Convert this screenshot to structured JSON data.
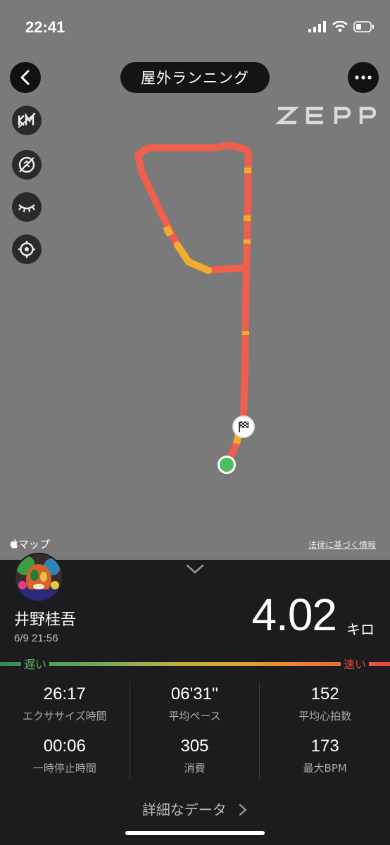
{
  "status_bar": {
    "time": "22:41"
  },
  "header": {
    "title": "屋外ランニング",
    "back_icon": "back-chevron-icon",
    "more_icon": "more-dots-icon"
  },
  "map": {
    "brand": "ZΣPP",
    "apple_maps_label": "マップ",
    "legal_link": "法律に基づく情報",
    "tools": [
      "km-marker-icon",
      "hide-pace-icon",
      "eye-closed-icon",
      "locate-icon"
    ],
    "start_color": "#4cbf63",
    "route_slow_color": "#f2ad2e",
    "route_fast_color": "#ee5f4d"
  },
  "summary": {
    "name": "井野桂吾",
    "date": "6/9 21:56",
    "distance": "4.02",
    "distance_unit": "キロ",
    "pace_slow_label": "遅い",
    "pace_fast_label": "速い"
  },
  "stats": [
    {
      "value": "26:17",
      "label": "エクササイズ時間"
    },
    {
      "value": "06'31''",
      "label": "平均ペース"
    },
    {
      "value": "152",
      "label": "平均心拍数"
    },
    {
      "value": "00:06",
      "label": "一時停止時間"
    },
    {
      "value": "305",
      "label": "消費"
    },
    {
      "value": "173",
      "label": "最大BPM"
    }
  ],
  "details_link": "詳細なデータ"
}
